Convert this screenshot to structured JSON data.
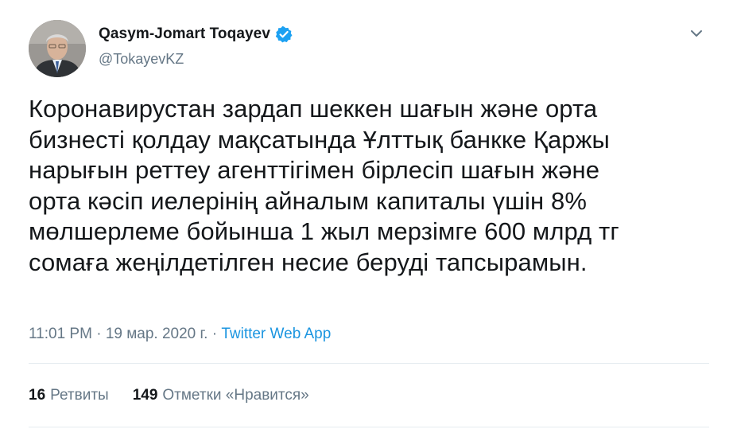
{
  "author": {
    "name": "Qasym-Jomart Toqayev",
    "handle": "@TokayevKZ"
  },
  "tweet": {
    "text": "Коронавирустан зардап шеккен шағын және орта\nбизнесті қолдау мақсатында Ұлттық банкке Қаржы\nнарығын реттеу агенттігімен бірлесіп шағын және\nорта кәсіп иелерінің айналым капиталы үшін 8%\nмөлшерлеме бойынша 1 жыл мерзімге 600 млрд тг\nсомаға жеңілдетілген несие беруді тапсырамын."
  },
  "meta": {
    "time": "11:01 PM",
    "sep1": " · ",
    "date": "19 мар. 2020 г.",
    "sep2": " · ",
    "source": "Twitter Web App"
  },
  "stats": {
    "retweets_count": "16",
    "retweets_label": "Ретвиты",
    "likes_count": "149",
    "likes_label": "Отметки «Нравится»"
  },
  "icons": {
    "verified": "verified-badge-icon",
    "caret": "chevron-down-icon"
  },
  "colors": {
    "accent": "#1b95e0",
    "verified": "#1da1f2",
    "secondary_text": "#657786",
    "divider": "#e6ecf0"
  }
}
